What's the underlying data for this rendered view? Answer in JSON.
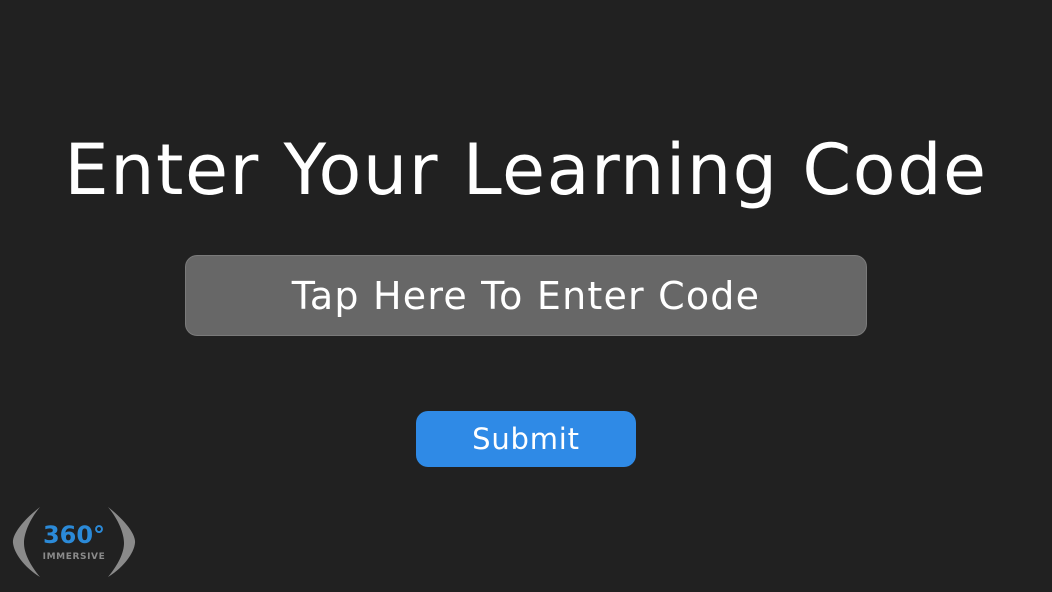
{
  "screen": {
    "title": "Enter Your Learning Code",
    "code_field_placeholder": "Tap Here To Enter Code",
    "submit_label": "Submit"
  },
  "logo": {
    "number": "360°",
    "text": "IMMERSIVE"
  },
  "colors": {
    "background": "#212121",
    "field": "#676767",
    "accent": "#2f8ae6",
    "logo_blue": "#2b8ad8",
    "logo_gray": "#8a8a8a"
  }
}
